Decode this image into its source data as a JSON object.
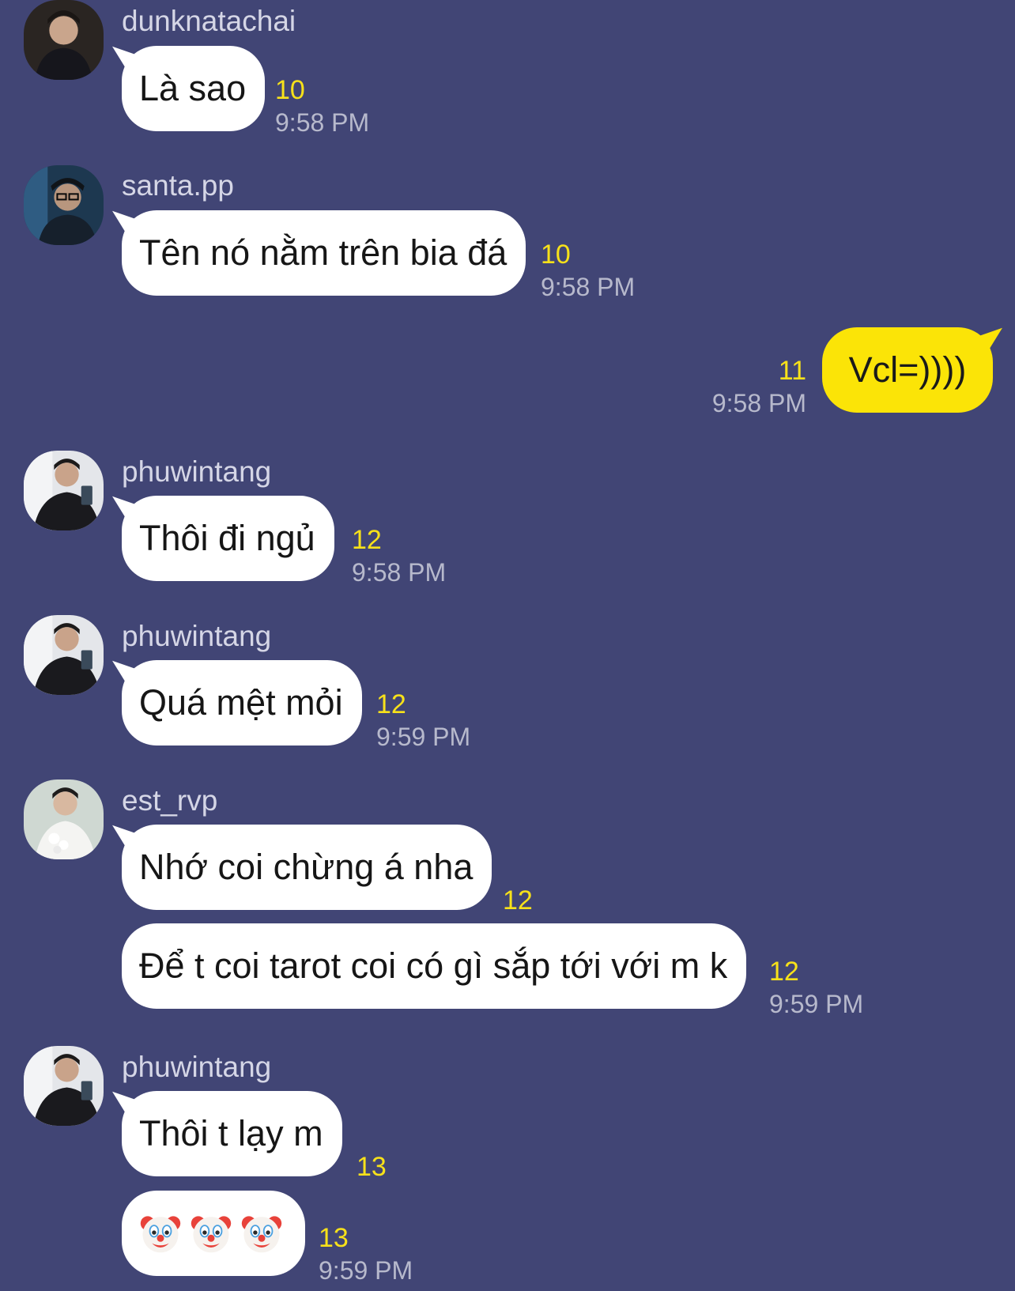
{
  "messages": [
    {
      "sender": "dunknatachai",
      "text": "Là sao",
      "count": "10",
      "time": "9:58 PM"
    },
    {
      "sender": "santa.pp",
      "text": "Tên nó nằm trên bia đá",
      "count": "10",
      "time": "9:58 PM"
    },
    {
      "sender": "",
      "text": "Vcl=))))",
      "count": "11",
      "time": "9:58 PM"
    },
    {
      "sender": "phuwintang",
      "text": "Thôi đi ngủ",
      "count": "12",
      "time": "9:58 PM"
    },
    {
      "sender": "phuwintang",
      "text": "Quá mệt mỏi",
      "count": "12",
      "time": "9:59 PM"
    },
    {
      "sender": "est_rvp",
      "text": "Nhớ coi chừng á nha",
      "count": "12",
      "time": ""
    },
    {
      "sender": "",
      "text": "Để t coi tarot coi có gì sắp tới với m k",
      "count": "12",
      "time": "9:59 PM"
    },
    {
      "sender": "phuwintang",
      "text": "Thôi t lạy m",
      "count": "13",
      "time": ""
    },
    {
      "sender": "",
      "emoji": [
        "clown-face",
        "clown-face",
        "clown-face"
      ],
      "count": "13",
      "time": "9:59 PM"
    }
  ],
  "colors": {
    "background": "#414575",
    "incoming_bubble": "#ffffff",
    "outgoing_bubble": "#fbe407",
    "read_count": "#f7e11a",
    "timestamp": "#b7b9cc",
    "sender_name": "#d5d6e6"
  }
}
